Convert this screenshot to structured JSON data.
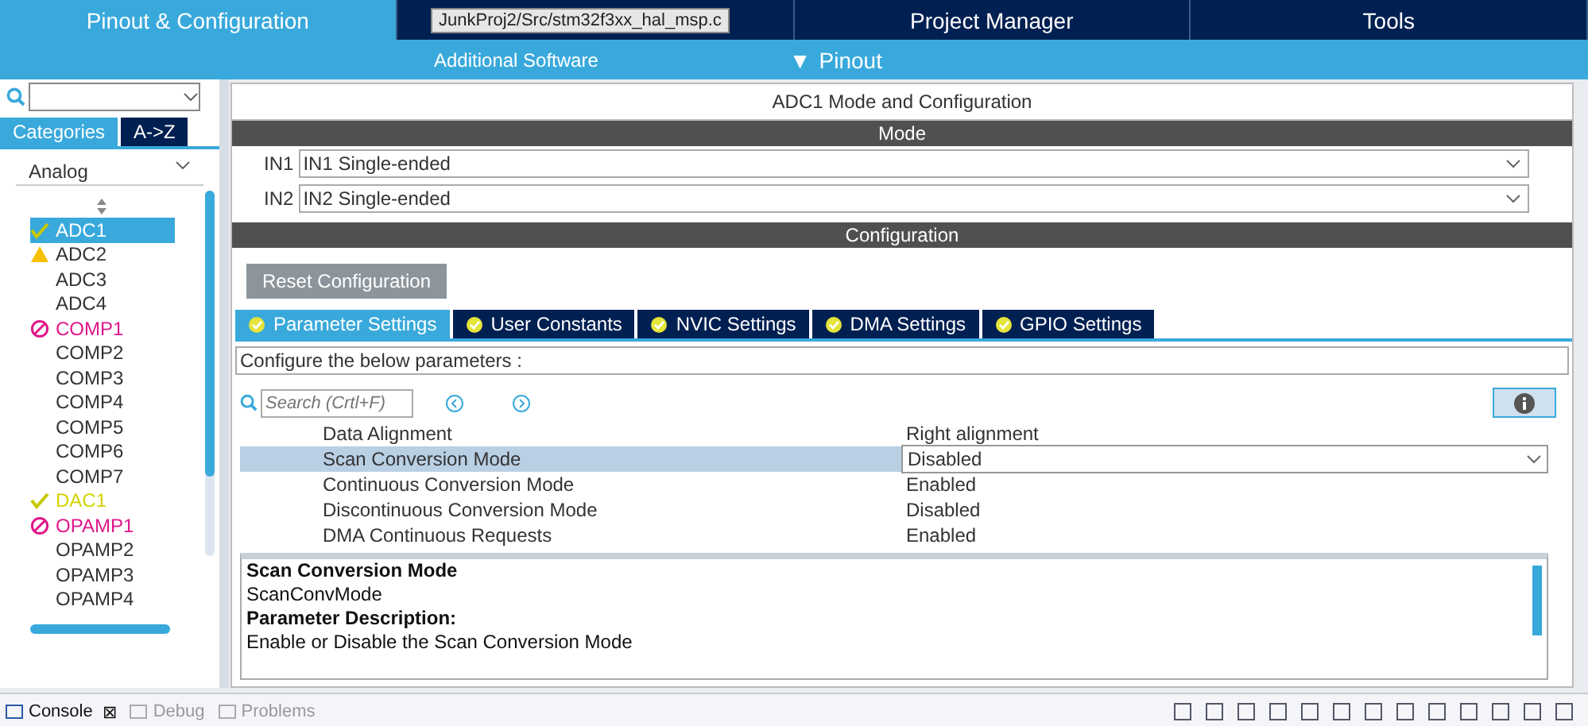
{
  "top_tabs": [
    {
      "label": "Pinout & Configuration",
      "selected": true
    },
    {
      "selected": false
    },
    {
      "label": "Project Manager",
      "selected": false
    },
    {
      "label": "Tools",
      "selected": false
    }
  ],
  "tooltip": "JunkProj2/Src/stm32f3xx_hal_msp.c",
  "sub_bar": {
    "additional": "Additional Software",
    "pinout": "Pinout",
    "pinout_icon": "▼"
  },
  "sidebar": {
    "view_tabs": [
      {
        "label": "Categories",
        "selected": true
      },
      {
        "label": "A->Z",
        "selected": false
      }
    ],
    "category": "Analog",
    "items": [
      {
        "label": "ADC1",
        "kind": "ok",
        "selected": true
      },
      {
        "label": "ADC2",
        "kind": "warning",
        "selected": false
      },
      {
        "label": "ADC3",
        "kind": "none",
        "selected": false
      },
      {
        "label": "ADC4",
        "kind": "none",
        "selected": false
      },
      {
        "label": "COMP1",
        "kind": "blocked",
        "selected": false
      },
      {
        "label": "COMP2",
        "kind": "none",
        "selected": false
      },
      {
        "label": "COMP3",
        "kind": "none",
        "selected": false
      },
      {
        "label": "COMP4",
        "kind": "none",
        "selected": false
      },
      {
        "label": "COMP5",
        "kind": "none",
        "selected": false
      },
      {
        "label": "COMP6",
        "kind": "none",
        "selected": false
      },
      {
        "label": "COMP7",
        "kind": "none",
        "selected": false
      },
      {
        "label": "DAC1",
        "kind": "ok",
        "selected": false
      },
      {
        "label": "OPAMP1",
        "kind": "blocked",
        "selected": false
      },
      {
        "label": "OPAMP2",
        "kind": "none",
        "selected": false
      },
      {
        "label": "OPAMP3",
        "kind": "none",
        "selected": false
      },
      {
        "label": "OPAMP4",
        "kind": "none",
        "selected": false
      }
    ]
  },
  "panel": {
    "title": "ADC1 Mode and Configuration",
    "mode": {
      "header": "Mode",
      "inputs": [
        {
          "label": "IN1",
          "value": "IN1 Single-ended"
        },
        {
          "label": "IN2",
          "value": "IN2 Single-ended"
        }
      ]
    },
    "configuration": {
      "header": "Configuration",
      "reset_button": "Reset Configuration",
      "tabs": [
        {
          "label": "Parameter Settings",
          "selected": true
        },
        {
          "label": "User Constants",
          "selected": false
        },
        {
          "label": "NVIC Settings",
          "selected": false
        },
        {
          "label": "DMA Settings",
          "selected": false
        },
        {
          "label": "GPIO Settings",
          "selected": false
        }
      ],
      "hint": "Configure the below parameters :",
      "search": {
        "placeholder": "Search (Crtl+F)"
      },
      "parameters": [
        {
          "name": "Data Alignment",
          "value": "Right alignment",
          "selected": false
        },
        {
          "name": "Scan Conversion Mode",
          "value": "Disabled",
          "selected": true
        },
        {
          "name": "Continuous Conversion Mode",
          "value": "Enabled",
          "selected": false
        },
        {
          "name": "Discontinuous Conversion Mode",
          "value": "Disabled",
          "selected": false
        },
        {
          "name": "DMA Continuous Requests",
          "value": "Enabled",
          "selected": false
        }
      ],
      "description": [
        {
          "text": "Scan Conversion Mode",
          "bold": true
        },
        {
          "text": "ScanConvMode",
          "bold": false
        },
        {
          "text": "Parameter Description:",
          "bold": true
        },
        {
          "text": "Enable or Disable the Scan Conversion Mode",
          "bold": false
        }
      ]
    }
  },
  "bottom_tabs": [
    {
      "label": "Console",
      "selected": true,
      "close": "⊠"
    },
    {
      "label": "Debug",
      "selected": false
    },
    {
      "label": "Problems",
      "selected": false
    }
  ]
}
